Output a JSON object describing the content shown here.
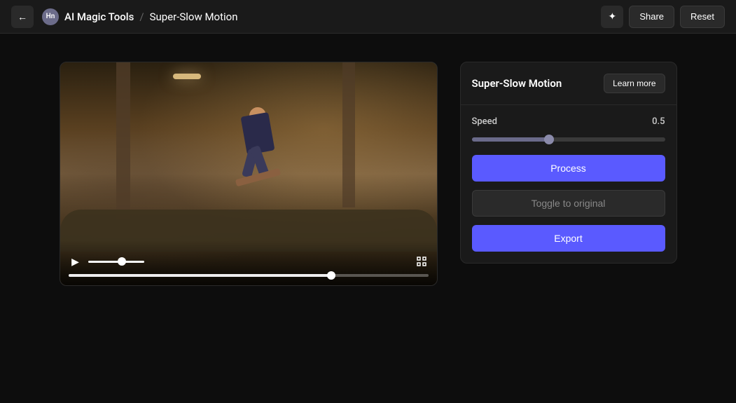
{
  "header": {
    "back_label": "←",
    "avatar_text": "Hn",
    "breadcrumb_main": "AI Magic Tools",
    "breadcrumb_separator": "/",
    "breadcrumb_sub": "Super-Slow Motion",
    "magic_icon": "✦",
    "share_label": "Share",
    "reset_label": "Reset"
  },
  "panel": {
    "title": "Super-Slow Motion",
    "learn_more_label": "Learn more",
    "speed_label": "Speed",
    "speed_value": "0.5",
    "speed_fill_percent": "40",
    "process_label": "Process",
    "toggle_label": "Toggle to original",
    "export_label": "Export"
  },
  "video": {
    "play_icon": "▶",
    "fullscreen_icon": "⛶"
  }
}
